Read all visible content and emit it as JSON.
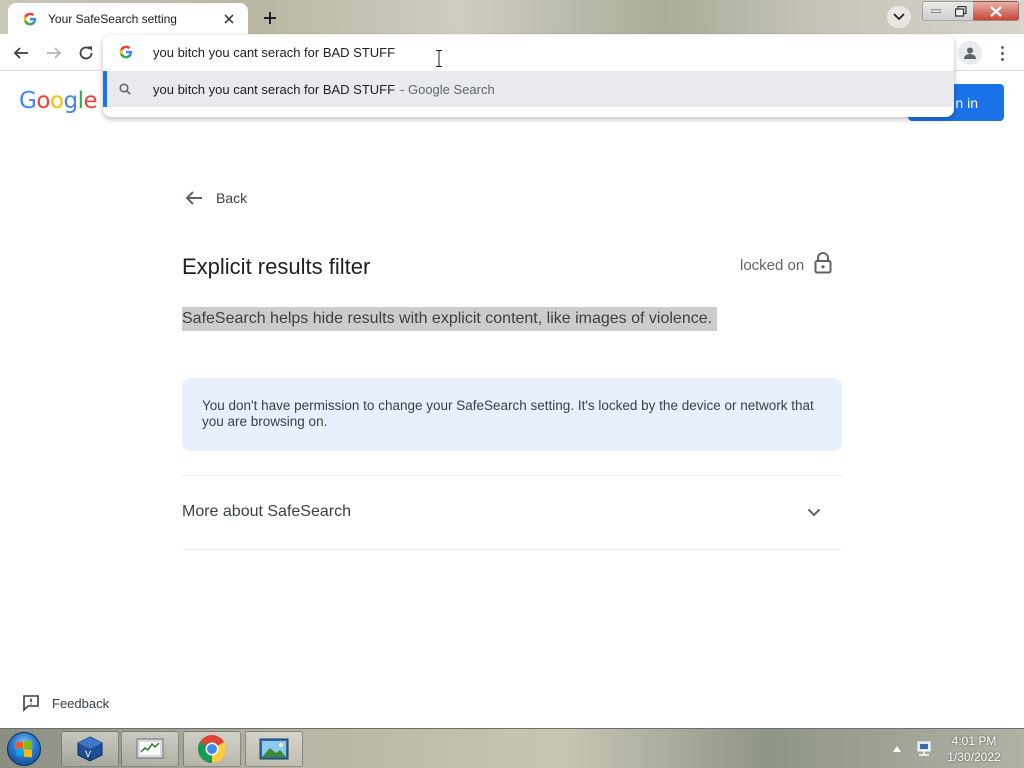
{
  "browser": {
    "tab": {
      "title": "Your SafeSearch setting"
    },
    "omnibox": {
      "query": "you bitch you cant serach for BAD STUFF",
      "suggestion": {
        "text": "you bitch you cant serach for BAD STUFF",
        "suffix": "- Google Search"
      }
    }
  },
  "page": {
    "logo_letters": [
      "G",
      "o",
      "o",
      "g",
      "l",
      "e"
    ],
    "signin_label": "n in",
    "back_label": "Back",
    "heading": "Explicit results filter",
    "locked_label": "locked on",
    "description": "SafeSearch helps hide results with explicit content, like images of violence.",
    "notice": "You don't have permission to change your SafeSearch setting. It's locked by the device or network that you are browsing on.",
    "more_label": "More about SafeSearch",
    "feedback_label": "Feedback"
  },
  "taskbar": {
    "time": "4:01 PM",
    "date": "1/30/2022"
  },
  "colors": {
    "accent": "#1a73e8",
    "notice_bg": "#e8f0fe",
    "highlight": "#cccccc"
  }
}
